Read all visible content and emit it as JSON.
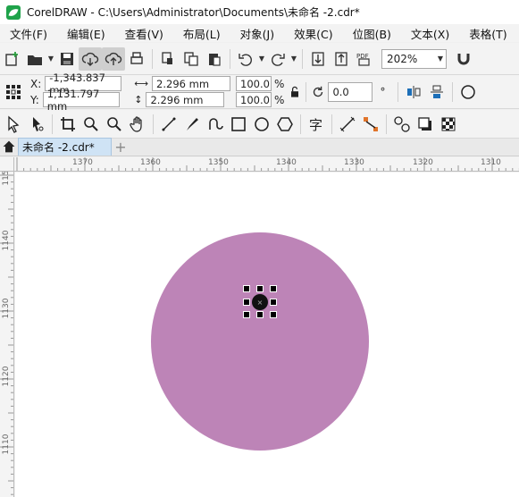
{
  "window": {
    "title": "CorelDRAW - C:\\Users\\Administrator\\Documents\\未命名 -2.cdr*"
  },
  "menu": [
    {
      "label": "文件(F)"
    },
    {
      "label": "编辑(E)"
    },
    {
      "label": "查看(V)"
    },
    {
      "label": "布局(L)"
    },
    {
      "label": "对象(J)"
    },
    {
      "label": "效果(C)"
    },
    {
      "label": "位图(B)"
    },
    {
      "label": "文本(X)"
    },
    {
      "label": "表格(T)"
    }
  ],
  "standard_toolbar": {
    "icons": [
      "new-document-icon",
      "open-folder-icon",
      "save-icon",
      "cloud-download-icon",
      "cloud-upload-icon",
      "print-icon",
      "cut-icon",
      "copy-icon",
      "paste-icon",
      "undo-icon",
      "redo-icon",
      "import-icon",
      "export-icon",
      "publish-pdf-icon"
    ],
    "zoom_level": "202%"
  },
  "property_bar": {
    "x_label": "X:",
    "y_label": "Y:",
    "x_value": "-1,343.837 mm",
    "y_value": "1,131.797 mm",
    "width_value": "2.296 mm",
    "height_value": "2.296 mm",
    "scale_x": "100.0",
    "scale_y": "100.0",
    "percent_symbol": "%",
    "rotation_value": "0.0",
    "degree_symbol": "°"
  },
  "toolbox": {
    "tools": [
      "pick-tool",
      "shape-tool",
      "crop-tool",
      "zoom-tool",
      "search-tool",
      "pan-tool",
      "freehand-tool",
      "artistic-media-tool",
      "smart-draw-tool",
      "rectangle-tool",
      "ellipse-tool",
      "polygon-tool",
      "text-tool",
      "dimension-tool",
      "connector-tool",
      "blend-tool",
      "shadow-tool",
      "transparency-tool"
    ]
  },
  "document_tab": {
    "label": "未命名 -2.cdr*"
  },
  "ruler": {
    "horizontal": [
      "1370",
      "1360",
      "1350",
      "1340",
      "1330",
      "1320",
      "1310"
    ],
    "vertical": [
      "115",
      "1140",
      "1130",
      "1120",
      "1110"
    ],
    "unit_mark": "毫米"
  },
  "canvas": {
    "circle_color": "#bd84b7"
  }
}
